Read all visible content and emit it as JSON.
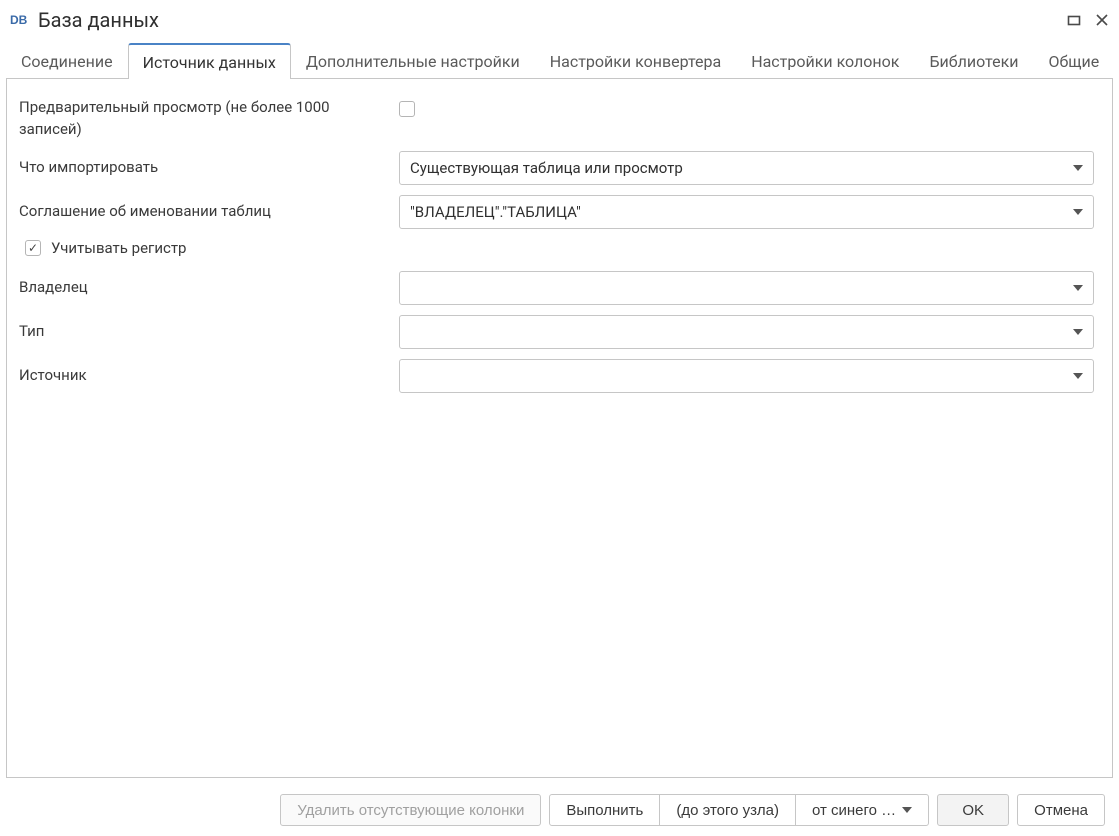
{
  "window": {
    "title": "База данных",
    "icon_label": "db-icon"
  },
  "tabs": [
    {
      "id": "connection",
      "label": "Соединение",
      "active": false
    },
    {
      "id": "datasource",
      "label": "Источник данных",
      "active": true
    },
    {
      "id": "advanced",
      "label": "Дополнительные настройки",
      "active": false
    },
    {
      "id": "converter",
      "label": "Настройки конвертера",
      "active": false
    },
    {
      "id": "columns",
      "label": "Настройки колонок",
      "active": false
    },
    {
      "id": "libraries",
      "label": "Библиотеки",
      "active": false
    },
    {
      "id": "general",
      "label": "Общие",
      "active": false
    }
  ],
  "form": {
    "preview_label": "Предварительный просмотр (не более 1000 записей)",
    "preview_checked": false,
    "what_import_label": "Что импортировать",
    "what_import_value": "Существующая таблица или просмотр",
    "naming_label": "Соглашение об именовании таблиц",
    "naming_value": "\"ВЛАДЕЛЕЦ\".\"ТАБЛИЦА\"",
    "case_sensitive_label": "Учитывать регистр",
    "case_sensitive_checked": true,
    "owner_label": "Владелец",
    "owner_value": "",
    "type_label": "Тип",
    "type_value": "",
    "source_label": "Источник",
    "source_value": ""
  },
  "footer": {
    "remove_missing_cols": "Удалить отсутствующие колонки",
    "execute": "Выполнить",
    "until_node": "(до этого узла)",
    "mode": "от синего …",
    "ok": "OK",
    "cancel": "Отмена"
  }
}
